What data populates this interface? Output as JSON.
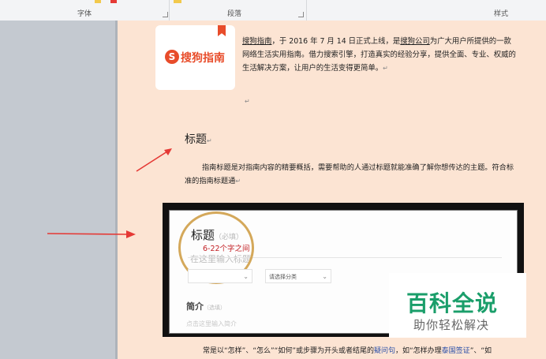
{
  "ribbon": {
    "groups": [
      "字体",
      "段落",
      "样式"
    ]
  },
  "logo": {
    "brand": "搜狗指南",
    "s_letter": "S"
  },
  "intro": {
    "pre": "",
    "brand_link": "搜狗指南",
    "mid": "，于 2016 年 7 月 14 日正式上线，是",
    "company_link": "搜狗公司",
    "rest": "为广大用户所提供的一款网络生活实用指南。借力搜索引擎，打造真实的经验分享，提供全面、专业、权威的生活解决方案，让用户的生活变得更简单。"
  },
  "para_mark": "↵",
  "heading": "标题",
  "body1": "指南标题是对指南内容的精要概括，需要帮助的人通过标题就能准确了解你想传达的主题。符合标准的指南标题通",
  "embedded_form": {
    "title_label": "标题",
    "title_required": "（必填）",
    "length_hint": "6-22个字之间",
    "title_placeholder": "在这里输入标题",
    "category_select": "",
    "subcategory_select": "请选择分类",
    "summary_label": "简介",
    "summary_required": "（选填）",
    "summary_placeholder": "点击这里输入简介"
  },
  "watermark": {
    "title": "百科全说",
    "subtitle": "助你轻松解决"
  },
  "body2": {
    "pre": "常是以“怎样”、“怎么”“如何”或步骤为开头或者结尾的",
    "link1": "疑问句",
    "mid": "，如“怎样办理",
    "link2": "泰国签证",
    "post": "”、“如"
  },
  "colors": {
    "page": "#fce4d3",
    "arrow": "#e53935",
    "accent_red": "#e84c2a",
    "watermark_green": "#1a9e6a",
    "circle": "#d4a85a"
  }
}
